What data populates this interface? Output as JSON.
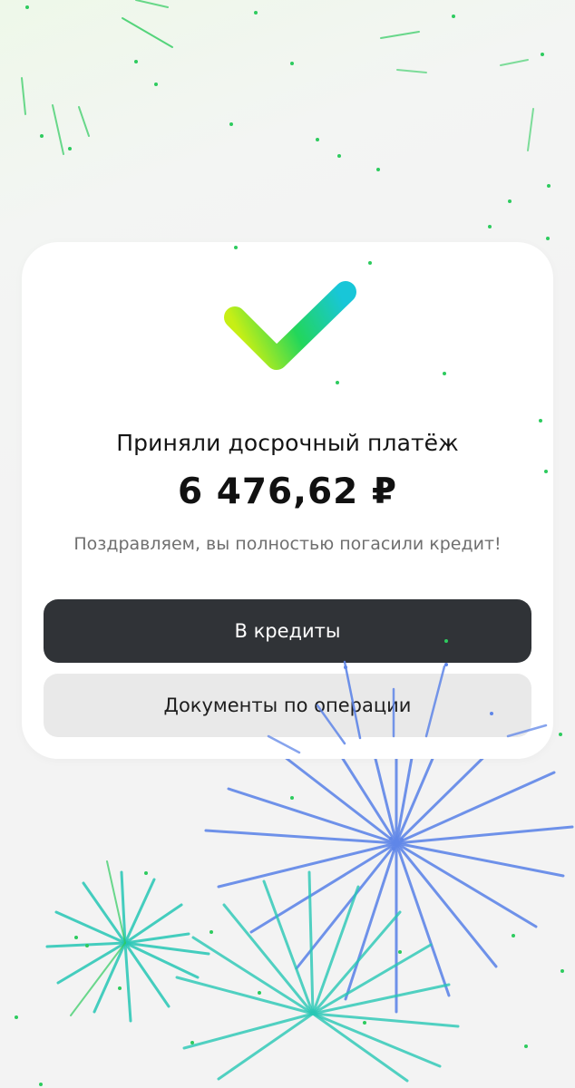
{
  "status": {
    "title": "Приняли досрочный платёж",
    "amount": "6 476,62 ₽",
    "message": "Поздравляем, вы полностью погасили кредит!"
  },
  "actions": {
    "primary_label": "В кредиты",
    "secondary_label": "Документы по операции"
  },
  "icons": {
    "success": "checkmark-icon"
  },
  "colors": {
    "check_gradient_start": "#c7ef15",
    "check_gradient_mid": "#22d65b",
    "check_gradient_end": "#18c6d8",
    "primary_button": "#303337",
    "secondary_button": "#e9e9e9",
    "confetti_green": "#32c85a",
    "confetti_teal": "#27c7b4",
    "confetti_blue": "#5f86e8"
  }
}
